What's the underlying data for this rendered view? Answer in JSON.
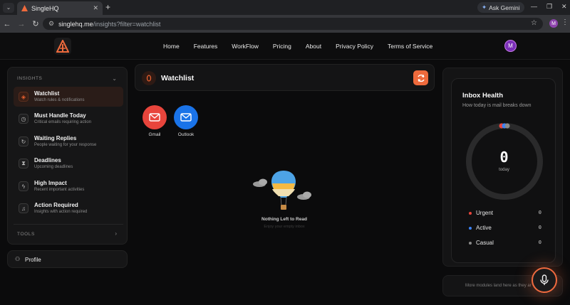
{
  "browser": {
    "tab_title": "SingleHQ",
    "ask_gemini": "Ask Gemini",
    "url_host": "singlehq.me",
    "url_path": "/insights?filter=watchlist",
    "profile_initial": "M"
  },
  "header": {
    "nav": [
      "Home",
      "Features",
      "WorkFlow",
      "Pricing",
      "About",
      "Privacy Policy",
      "Terms of Service"
    ],
    "avatar_initial": "M"
  },
  "sidebar": {
    "section_insights": "INSIGHTS",
    "section_tools": "TOOLS",
    "items": [
      {
        "title": "Watchlist",
        "subtitle": "Watch rules & notifications",
        "icon": "tag-icon"
      },
      {
        "title": "Must Handle Today",
        "subtitle": "Critical emails requiring action",
        "icon": "clock-icon"
      },
      {
        "title": "Waiting Replies",
        "subtitle": "People waiting for your response",
        "icon": "refresh-icon"
      },
      {
        "title": "Deadlines",
        "subtitle": "Upcoming deadlines",
        "icon": "hourglass-icon"
      },
      {
        "title": "High Impact",
        "subtitle": "Recent important activities",
        "icon": "bolt-icon"
      },
      {
        "title": "Action Required",
        "subtitle": "Insights with action required",
        "icon": "bell-icon"
      }
    ],
    "profile_label": "Profile"
  },
  "main": {
    "title": "Watchlist",
    "providers": [
      {
        "label": "Gmail",
        "color": "#e8453c"
      },
      {
        "label": "Outlook",
        "color": "#1a73e8"
      }
    ],
    "empty_title": "Nothing Left to Read",
    "empty_subtitle": "Enjoy your empty inbox"
  },
  "health": {
    "title": "Inbox Health",
    "subtitle": "How today is mail breaks down",
    "count": "0",
    "count_label": "today",
    "legend": [
      {
        "label": "Urgent",
        "value": "0",
        "color": "#e8453c"
      },
      {
        "label": "Active",
        "value": "0",
        "color": "#3b82f6"
      },
      {
        "label": "Casual",
        "value": "0",
        "color": "#8a8a8a"
      }
    ]
  },
  "modules_text": "More modules land here as they ar"
}
